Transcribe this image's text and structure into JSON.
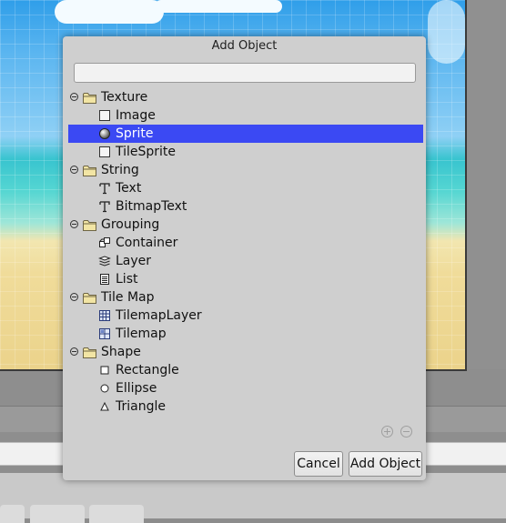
{
  "dialog": {
    "title": "Add Object",
    "search": {
      "value": "",
      "placeholder": ""
    },
    "groups": [
      {
        "label": "Texture",
        "items": [
          {
            "label": "Image",
            "icon": "image-icon"
          },
          {
            "label": "Sprite",
            "icon": "sprite-icon",
            "selected": true
          },
          {
            "label": "TileSprite",
            "icon": "tilesprite-icon"
          }
        ]
      },
      {
        "label": "String",
        "items": [
          {
            "label": "Text",
            "icon": "text-icon"
          },
          {
            "label": "BitmapText",
            "icon": "bitmaptext-icon"
          }
        ]
      },
      {
        "label": "Grouping",
        "items": [
          {
            "label": "Container",
            "icon": "container-icon"
          },
          {
            "label": "Layer",
            "icon": "layer-icon"
          },
          {
            "label": "List",
            "icon": "list-icon"
          }
        ]
      },
      {
        "label": "Tile Map",
        "items": [
          {
            "label": "TilemapLayer",
            "icon": "tilemaplayer-icon"
          },
          {
            "label": "Tilemap",
            "icon": "tilemap-icon"
          }
        ]
      },
      {
        "label": "Shape",
        "items": [
          {
            "label": "Rectangle",
            "icon": "rectangle-icon"
          },
          {
            "label": "Ellipse",
            "icon": "ellipse-icon"
          },
          {
            "label": "Triangle",
            "icon": "triangle-icon"
          }
        ]
      }
    ],
    "buttons": {
      "cancel": "Cancel",
      "add": "Add Object"
    }
  },
  "colors": {
    "selection": "#3b49f3",
    "dialog_bg": "#cfcfcf"
  }
}
